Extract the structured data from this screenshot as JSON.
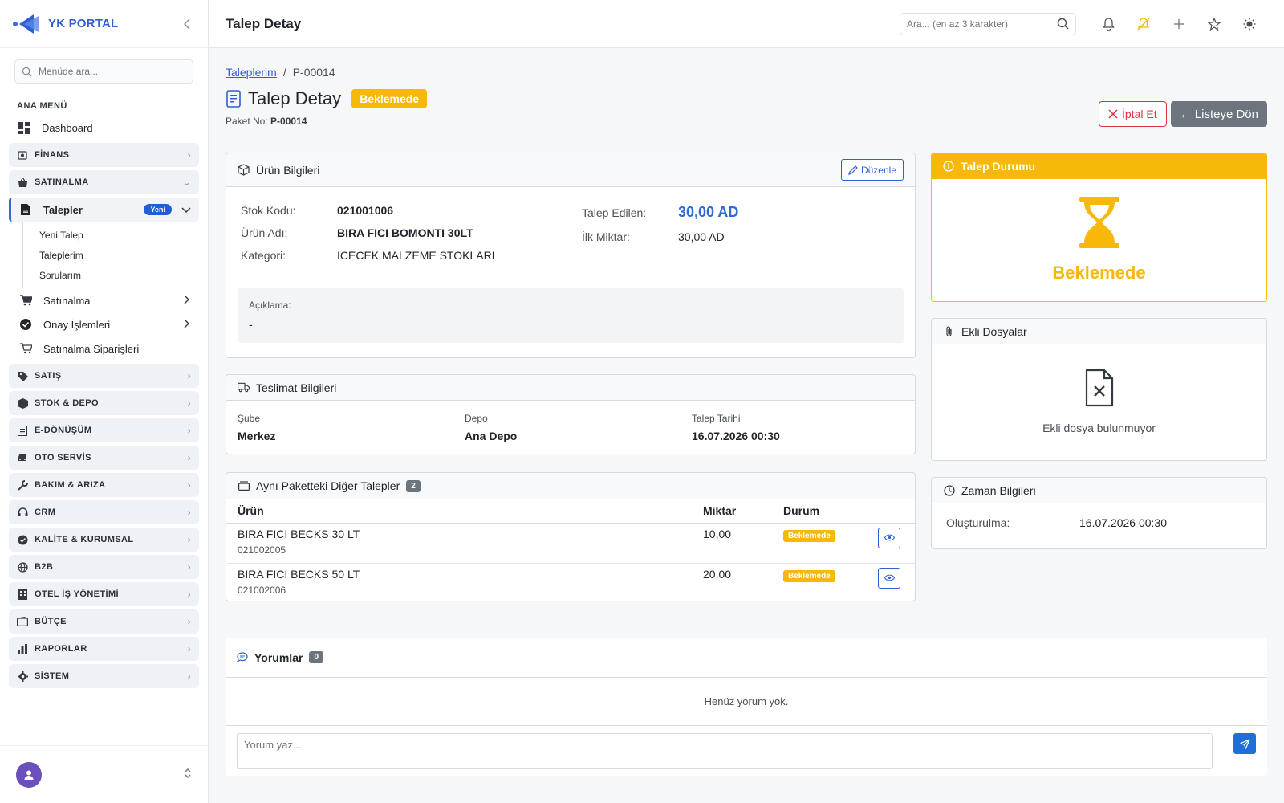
{
  "brand": {
    "name": "YK PORTAL"
  },
  "sidebar": {
    "search_placeholder": "Menüde ara...",
    "heading": "ANA MENÜ",
    "dashboard": "Dashboard",
    "groups": {
      "finans": "FİNANS",
      "satinalma": "SATINALMA",
      "satis": "SATIŞ",
      "stok": "STOK & DEPO",
      "edonusum": "E-DÖNÜŞÜM",
      "oto": "OTO SERVİS",
      "bakim": "BAKIM & ARIZA",
      "crm": "CRM",
      "kalite": "KALİTE & KURUMSAL",
      "b2b": "B2B",
      "otel": "OTEL İŞ YÖNETİMİ",
      "butce": "BÜTÇE",
      "raporlar": "RAPORLAR",
      "sistem": "SİSTEM"
    },
    "talepler": {
      "label": "Talepler",
      "badge": "Yeni"
    },
    "talepler_sub": [
      "Yeni Talep",
      "Taleplerim",
      "Sorularım"
    ],
    "satinalma_items": {
      "satinalma": "Satınalma",
      "onay": "Onay İşlemleri",
      "siparis": "Satınalma Siparişleri"
    }
  },
  "topbar": {
    "title": "Talep Detay",
    "search_placeholder": "Ara... (en az 3 karakter)"
  },
  "breadcrumb": {
    "parent": "Taleplerim",
    "current": "P-00014"
  },
  "header": {
    "title": "Talep Detay",
    "status_badge": "Beklemede",
    "packet_label": "Paket No:",
    "packet_value": "P-00014",
    "cancel_label": "İptal Et",
    "back_label": "← Listeye Dön"
  },
  "product": {
    "title": "Ürün Bilgileri",
    "edit_label": "Düzenle",
    "stock_code_label": "Stok Kodu:",
    "stock_code": "021001006",
    "name_label": "Ürün Adı:",
    "name": "BIRA FICI BOMONTI 30LT",
    "category_label": "Kategori:",
    "category": "ICECEK MALZEME STOKLARI",
    "requested_label": "Talep Edilen:",
    "requested": "30,00 AD",
    "initial_label": "İlk Miktar:",
    "initial": "30,00 AD",
    "note_label": "Açıklama:",
    "note": "-"
  },
  "delivery": {
    "title": "Teslimat Bilgileri",
    "branch_label": "Şube",
    "branch": "Merkez",
    "depot_label": "Depo",
    "depot": "Ana Depo",
    "date_label": "Talep Tarihi",
    "date": "16.07.2026 00:30"
  },
  "others": {
    "title": "Aynı Paketteki Diğer Talepler",
    "count": "2",
    "columns": [
      "Ürün",
      "Miktar",
      "Durum"
    ],
    "rows": [
      {
        "name": "BIRA FICI BECKS 30 LT",
        "code": "021002005",
        "qty": "10,00",
        "status": "Beklemede"
      },
      {
        "name": "BIRA FICI BECKS 50 LT",
        "code": "021002006",
        "qty": "20,00",
        "status": "Beklemede"
      }
    ]
  },
  "status_card": {
    "title": "Talep Durumu",
    "status": "Beklemede",
    "color": "#f8b80a"
  },
  "files": {
    "title": "Ekli Dosyalar",
    "empty": "Ekli dosya bulunmuyor"
  },
  "time": {
    "title": "Zaman Bilgileri",
    "created_label": "Oluşturulma:",
    "created": "16.07.2026 00:30"
  },
  "comments": {
    "title": "Yorumlar",
    "count": "0",
    "empty": "Henüz yorum yok.",
    "placeholder": "Yorum yaz..."
  },
  "colors": {
    "accent": "#2f5fd0",
    "warning": "#f8b80a",
    "danger": "#dc3545",
    "secondary": "#6c757d"
  }
}
